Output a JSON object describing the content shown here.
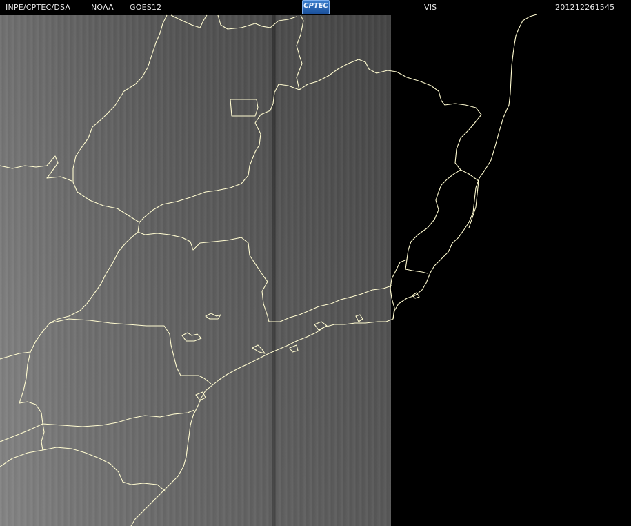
{
  "header": {
    "organization": "INPE/CPTEC/DSA",
    "agency": "NOAA",
    "satellite": "GOES12",
    "logo_text": "CPTEC",
    "channel": "VIS",
    "timestamp": "201212261545"
  },
  "colors": {
    "background": "#000000",
    "header_text": "#e8e8e8",
    "boundary_lines": "#fffbd0",
    "logo_blue": "#2a63b5"
  }
}
